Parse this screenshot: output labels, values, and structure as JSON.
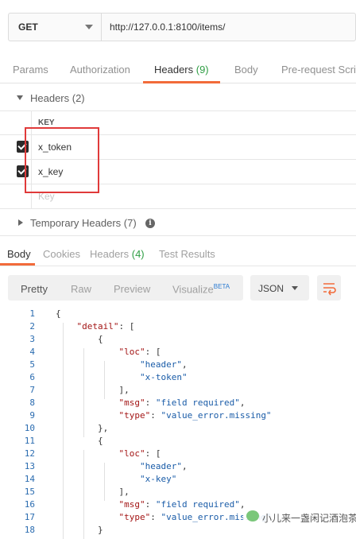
{
  "request": {
    "method": "GET",
    "url": "http://127.0.0.1:8100/items/"
  },
  "request_tabs": [
    {
      "label": "Params"
    },
    {
      "label": "Authorization"
    },
    {
      "label": "Headers ",
      "count": "(9)"
    },
    {
      "label": "Body"
    },
    {
      "label": "Pre-request Script"
    }
  ],
  "headers_section": {
    "title": "Headers (2)",
    "key_column": "KEY",
    "rows": [
      "x_token",
      "x_key"
    ],
    "key_placeholder": "Key"
  },
  "temp_headers": {
    "title": "Temporary Headers (7)",
    "info": "i"
  },
  "response_tabs": [
    {
      "label": "Body"
    },
    {
      "label": "Cookies"
    },
    {
      "label": "Headers ",
      "count": "(4)"
    },
    {
      "label": "Test Results"
    }
  ],
  "view_modes": [
    "Pretty",
    "Raw",
    "Preview",
    "Visualize"
  ],
  "beta": "BETA",
  "format": "JSON",
  "colors": {
    "accent": "#f26b3a",
    "count_green": "#2f9e44",
    "line_numbers": "#2b6cb0",
    "json_key": "#a31515",
    "json_string": "#1a5ca8"
  },
  "code_lines": [
    {
      "n": "1",
      "t": "{"
    },
    {
      "n": "2",
      "t": "    \"detail\": ["
    },
    {
      "n": "3",
      "t": "        {"
    },
    {
      "n": "4",
      "t": "            \"loc\": ["
    },
    {
      "n": "5",
      "t": "                \"header\","
    },
    {
      "n": "6",
      "t": "                \"x-token\""
    },
    {
      "n": "7",
      "t": "            ],"
    },
    {
      "n": "8",
      "t": "            \"msg\": \"field required\","
    },
    {
      "n": "9",
      "t": "            \"type\": \"value_error.missing\""
    },
    {
      "n": "10",
      "t": "        },"
    },
    {
      "n": "11",
      "t": "        {"
    },
    {
      "n": "12",
      "t": "            \"loc\": ["
    },
    {
      "n": "13",
      "t": "                \"header\","
    },
    {
      "n": "14",
      "t": "                \"x-key\""
    },
    {
      "n": "15",
      "t": "            ],"
    },
    {
      "n": "16",
      "t": "            \"msg\": \"field required\","
    },
    {
      "n": "17",
      "t": "            \"type\": \"value_error.missing\""
    },
    {
      "n": "18",
      "t": "        }"
    }
  ],
  "watermark": "小儿来一盏闲记酒泡茶"
}
